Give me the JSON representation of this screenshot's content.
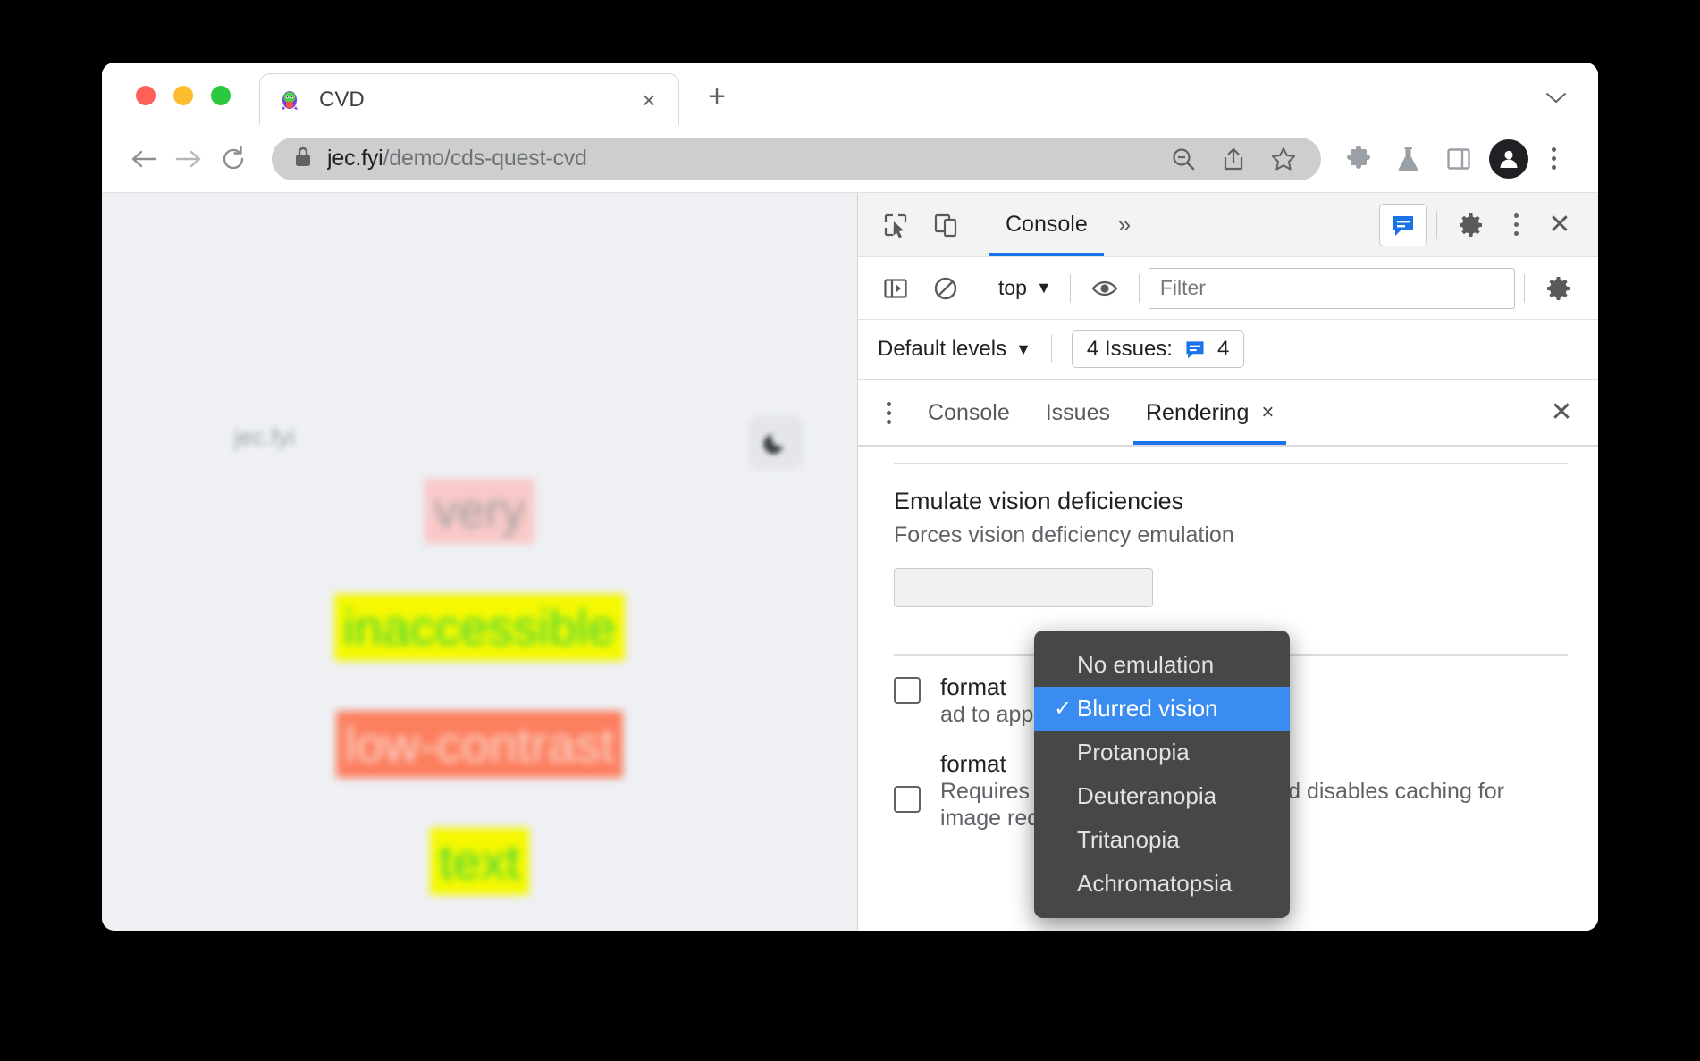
{
  "browser": {
    "traffic_lights": [
      "close",
      "minimize",
      "maximize"
    ],
    "tab": {
      "title": "CVD",
      "favicon": "penguin-favicon",
      "close_label": "×"
    },
    "new_tab_label": "+",
    "tabstrip_chevron": "⌄",
    "omnibox": {
      "url_host": "jec.fyi",
      "url_path": "/demo/cds-quest-cvd",
      "lock_icon": "lock-icon",
      "zoom_out_icon": "zoom-out-icon",
      "share_icon": "share-icon",
      "bookmark_icon": "bookmark-star-icon"
    },
    "toolbar_icons": [
      "extensions-puzzle-icon",
      "labs-flask-icon",
      "side-panel-icon",
      "profile-avatar",
      "browser-menu-kebab"
    ]
  },
  "page": {
    "logo_text": "jec.fyi",
    "dark_mode_icon": "moon-icon",
    "words": [
      {
        "text": "very",
        "bg": "#f9c8c8",
        "fg": "#a0a0a0"
      },
      {
        "text": "inaccessible",
        "bg": "#f5f800",
        "fg": "#3fd43f"
      },
      {
        "text": "low-contrast",
        "bg": "#fc7f5f",
        "fg": "#fbd6cd"
      },
      {
        "text": "text",
        "bg": "#f5f800",
        "fg": "#3fd43f"
      }
    ]
  },
  "devtools": {
    "toolbar": {
      "inspect_icon": "inspect-cursor-icon",
      "device_icon": "device-toolbar-icon",
      "active_tab": "Console",
      "more_tabs": "»",
      "message_icon": "console-message-icon",
      "settings_icon": "gear-icon",
      "menu_icon": "kebab-menu-icon",
      "close_icon": "close-icon"
    },
    "filterbar": {
      "sidebar_toggle_icon": "console-sidebar-icon",
      "clear_icon": "clear-console-icon",
      "context": "top",
      "context_caret": "▼",
      "eye_icon": "live-expression-eye-icon",
      "filter_placeholder": "Filter",
      "filter_value": "",
      "settings_icon": "console-settings-gear-icon"
    },
    "levelsbar": {
      "levels_label": "Default levels",
      "levels_caret": "▼",
      "issues_label": "4 Issues:",
      "issues_icon": "issues-message-icon",
      "issues_count": "4"
    },
    "drawer": {
      "kebab": "drawer-menu-kebab",
      "tabs": [
        {
          "label": "Console",
          "active": false,
          "closable": false
        },
        {
          "label": "Issues",
          "active": false,
          "closable": false
        },
        {
          "label": "Rendering",
          "active": true,
          "closable": true,
          "close_label": "×"
        }
      ],
      "close_label": "×"
    },
    "rendering": {
      "section_title": "Emulate vision deficiencies",
      "section_desc": "Forces vision deficiency emulation",
      "options": [
        {
          "label": "No emulation",
          "selected": false
        },
        {
          "label": "Blurred vision",
          "selected": true
        },
        {
          "label": "Protanopia",
          "selected": false
        },
        {
          "label": "Deuteranopia",
          "selected": false
        },
        {
          "label": "Tritanopia",
          "selected": false
        },
        {
          "label": "Achromatopsia",
          "selected": false
        }
      ],
      "checkmark": "✓",
      "checkboxes": [
        {
          "label": "format",
          "sub": "ad to apply and disables quests.",
          "checked": false
        },
        {
          "label": "format",
          "sub": "Requires a page reload to apply and disables caching for image requests.",
          "checked": false
        }
      ]
    }
  },
  "colors": {
    "accent_blue": "#1a73e8",
    "menu_highlight": "#3a8cf0",
    "menu_bg": "#474747",
    "page_bg": "#eef0f4"
  }
}
